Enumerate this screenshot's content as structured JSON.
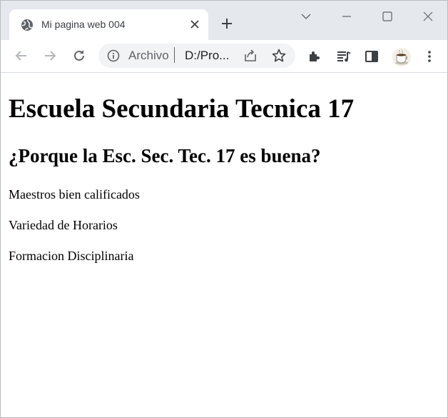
{
  "tab": {
    "title": "Mi pagina web 004"
  },
  "omnibox": {
    "chip": "Archivo",
    "url": "D:/Pro..."
  },
  "page": {
    "heading": "Escuela Secundaria Tecnica 17",
    "subheading": "¿Porque la Esc. Sec. Tec. 17 es buena?",
    "items": [
      "Maestros bien calificados",
      "Variedad de Horarios",
      "Formacion Disciplinaria"
    ]
  },
  "colors": {
    "tabstrip": "#e5e8ec",
    "omnibox": "#f1f3f4",
    "icon": "#5f6368",
    "text": "#202124"
  }
}
